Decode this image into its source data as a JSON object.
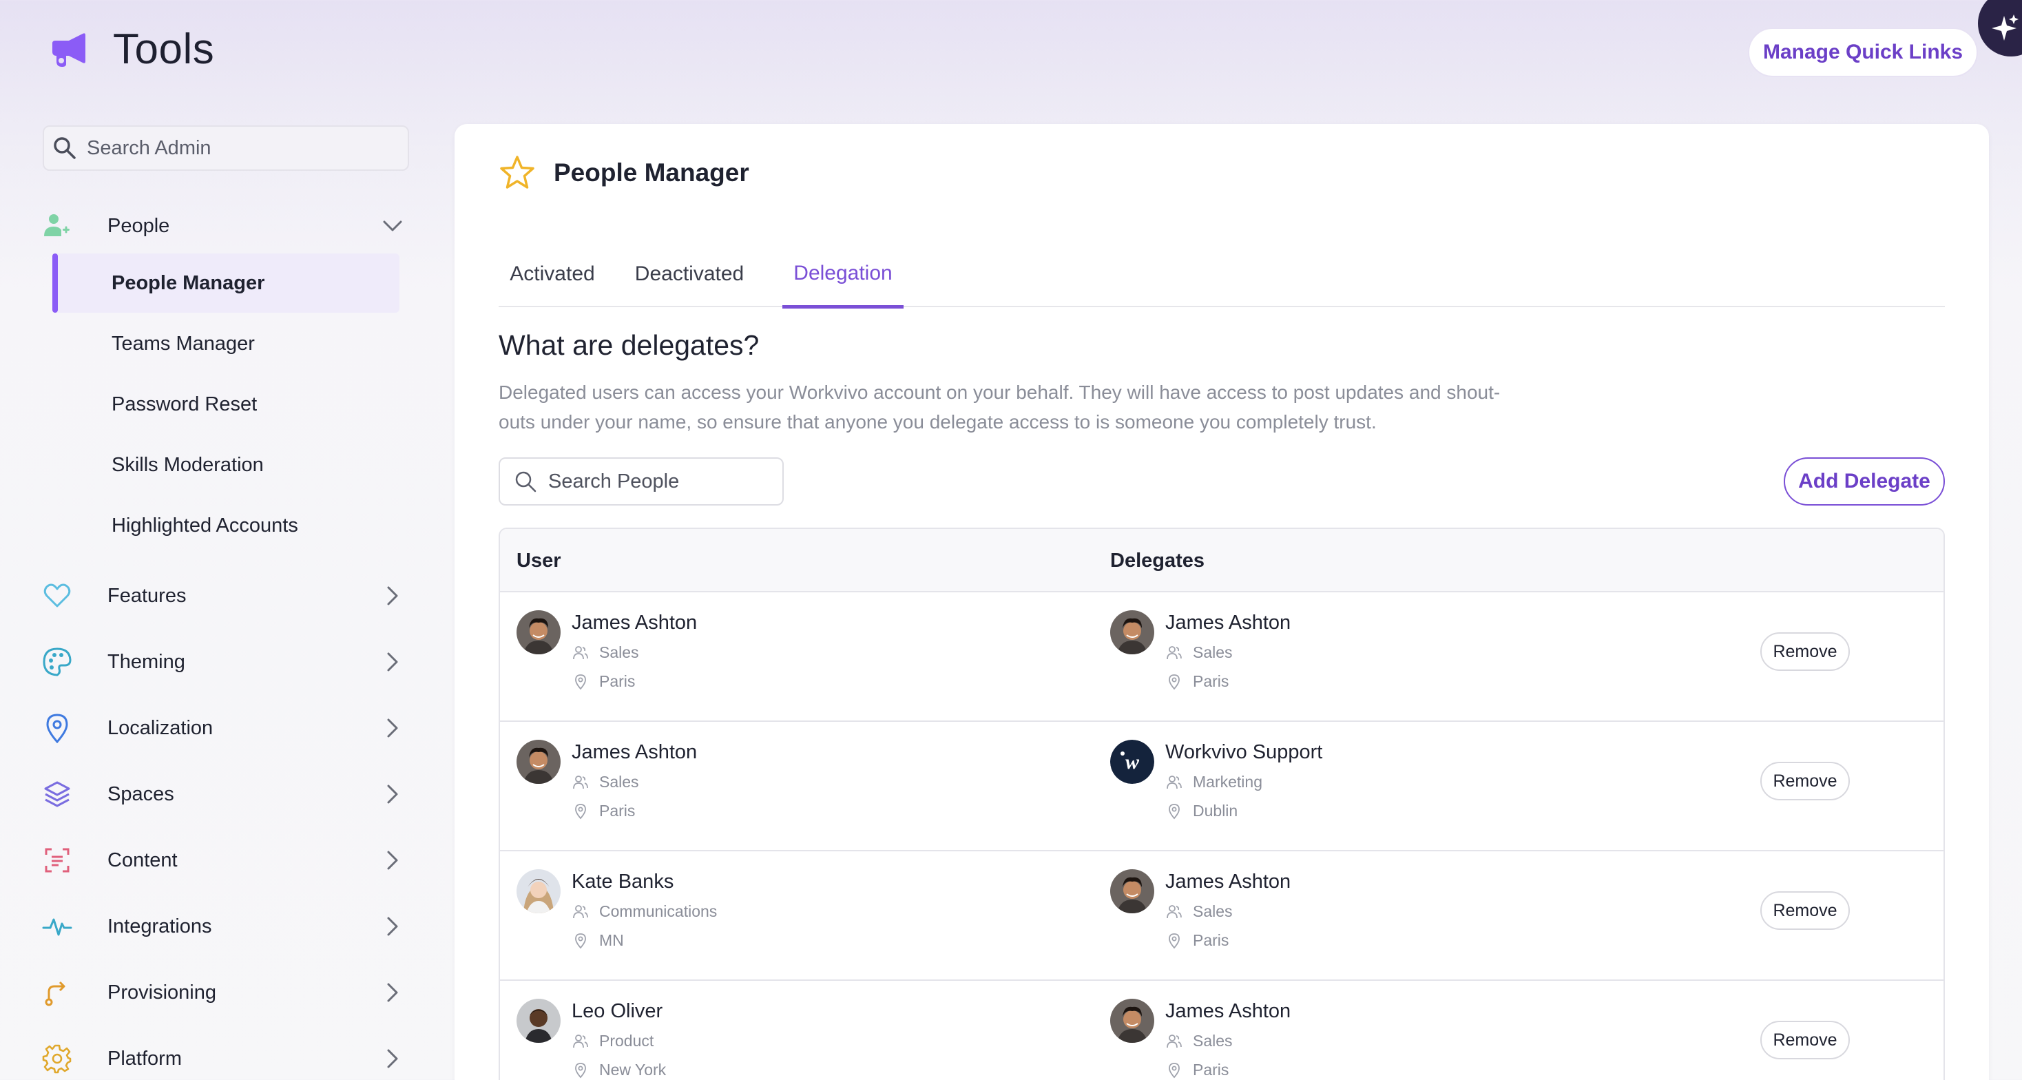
{
  "app": {
    "title": "Tools",
    "quick_links_label": "Manage Quick Links"
  },
  "sidebar": {
    "search_placeholder": "Search Admin",
    "people": {
      "label": "People",
      "items": [
        "People Manager",
        "Teams Manager",
        "Password Reset",
        "Skills Moderation",
        "Highlighted Accounts"
      ],
      "active": "People Manager"
    },
    "groups": [
      {
        "label": "Features",
        "icon": "heart-icon"
      },
      {
        "label": "Theming",
        "icon": "palette-icon"
      },
      {
        "label": "Localization",
        "icon": "location-pin-icon"
      },
      {
        "label": "Spaces",
        "icon": "layers-icon"
      },
      {
        "label": "Content",
        "icon": "content-scan-icon"
      },
      {
        "label": "Integrations",
        "icon": "pulse-icon"
      },
      {
        "label": "Provisioning",
        "icon": "route-icon"
      },
      {
        "label": "Platform",
        "icon": "gear-icon"
      }
    ]
  },
  "main": {
    "title": "People Manager",
    "tabs": [
      "Activated",
      "Deactivated",
      "Delegation"
    ],
    "active_tab": "Delegation",
    "section_title": "What are delegates?",
    "section_desc_line1": "Delegated users can access your Workvivo account on your behalf. They will have access to post updates and shout-",
    "section_desc_line2": "outs under your name, so ensure that anyone you delegate access to is someone you completely trust.",
    "search_placeholder": "Search People",
    "add_delegate_label": "Add Delegate",
    "table": {
      "headers": {
        "user": "User",
        "delegates": "Delegates"
      },
      "remove_label": "Remove",
      "rows": [
        {
          "user": {
            "name": "James Ashton",
            "team": "Sales",
            "location": "Paris"
          },
          "delegate": {
            "name": "James Ashton",
            "team": "Sales",
            "location": "Paris"
          }
        },
        {
          "user": {
            "name": "James Ashton",
            "team": "Sales",
            "location": "Paris"
          },
          "delegate": {
            "name": "Workvivo Support",
            "team": "Marketing",
            "location": "Dublin"
          }
        },
        {
          "user": {
            "name": "Kate Banks",
            "team": "Communications",
            "location": "MN"
          },
          "delegate": {
            "name": "James Ashton",
            "team": "Sales",
            "location": "Paris"
          }
        },
        {
          "user": {
            "name": "Leo Oliver",
            "team": "Product",
            "location": "New York"
          },
          "delegate": {
            "name": "James Ashton",
            "team": "Sales",
            "location": "Paris"
          }
        }
      ]
    }
  },
  "colors": {
    "accent": "#7a4fd6",
    "brand": "#8b5cf6",
    "corner_badge": "#2a2346"
  }
}
